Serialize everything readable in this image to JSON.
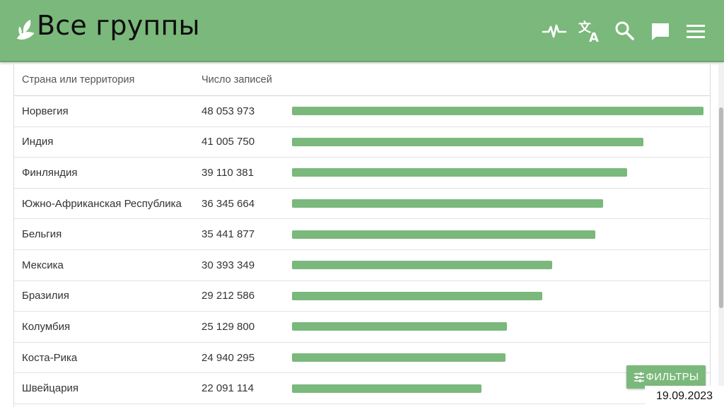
{
  "header": {
    "title": "Все группы",
    "icons": [
      "leaf-logo-icon",
      "activity-pulse-icon",
      "translate-icon",
      "search-icon",
      "chat-icon",
      "menu-icon"
    ],
    "background_color": "#7bb87b"
  },
  "table": {
    "columns": [
      "Страна или территория",
      "Число записей"
    ],
    "bar_color": "#7bb87b",
    "rows": [
      {
        "country": "Норвегия",
        "count": "48 053 973",
        "value": 48053973
      },
      {
        "country": "Индия",
        "count": "41 005 750",
        "value": 41005750
      },
      {
        "country": "Финляндия",
        "count": "39 110 381",
        "value": 39110381
      },
      {
        "country": "Южно-Африканская Республика",
        "count": "36 345 664",
        "value": 36345664
      },
      {
        "country": "Бельгия",
        "count": "35 441 877",
        "value": 35441877
      },
      {
        "country": "Мексика",
        "count": "30 393 349",
        "value": 30393349
      },
      {
        "country": "Бразилия",
        "count": "29 212 586",
        "value": 29212586
      },
      {
        "country": "Колумбия",
        "count": "25 129 800",
        "value": 25129800
      },
      {
        "country": "Коста-Рика",
        "count": "24 940 295",
        "value": 24940295
      },
      {
        "country": "Швейцария",
        "count": "22 091 114",
        "value": 22091114
      }
    ]
  },
  "filters_button": {
    "label": "ФИЛЬТРЫ",
    "icon": "filter-sliders-icon"
  },
  "date_stamp": "19.09.2023"
}
